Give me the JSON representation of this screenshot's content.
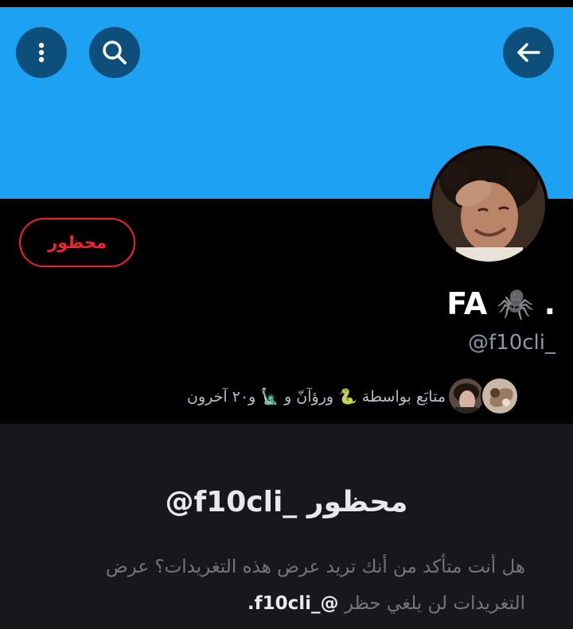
{
  "header": {
    "more_icon": "more-vertical-icon",
    "search_icon": "search-icon",
    "back_icon": "arrow-left-icon",
    "banner_color": "#1da1f2"
  },
  "profile": {
    "blocked_label": "محظور",
    "display_name": "FA",
    "name_emoji": "🕷️",
    "name_dot": ".",
    "handle": "@f10cli_",
    "followers_text": "متابَع بواسطة 🐍 ورؤآنّ و 🗽 و٢٠ آخرون"
  },
  "blocked_notice": {
    "title": "@f10cli_ محظور",
    "description": "هل أنت متأكد من أنك تريد عرض هذه التغريدات؟ عرض التغريدات لن يلغي حظر",
    "description_handle": "@_f10cli."
  },
  "colors": {
    "blocked_red": "#f4212e",
    "panel_bg": "#16181c",
    "muted_text": "#71767b"
  }
}
